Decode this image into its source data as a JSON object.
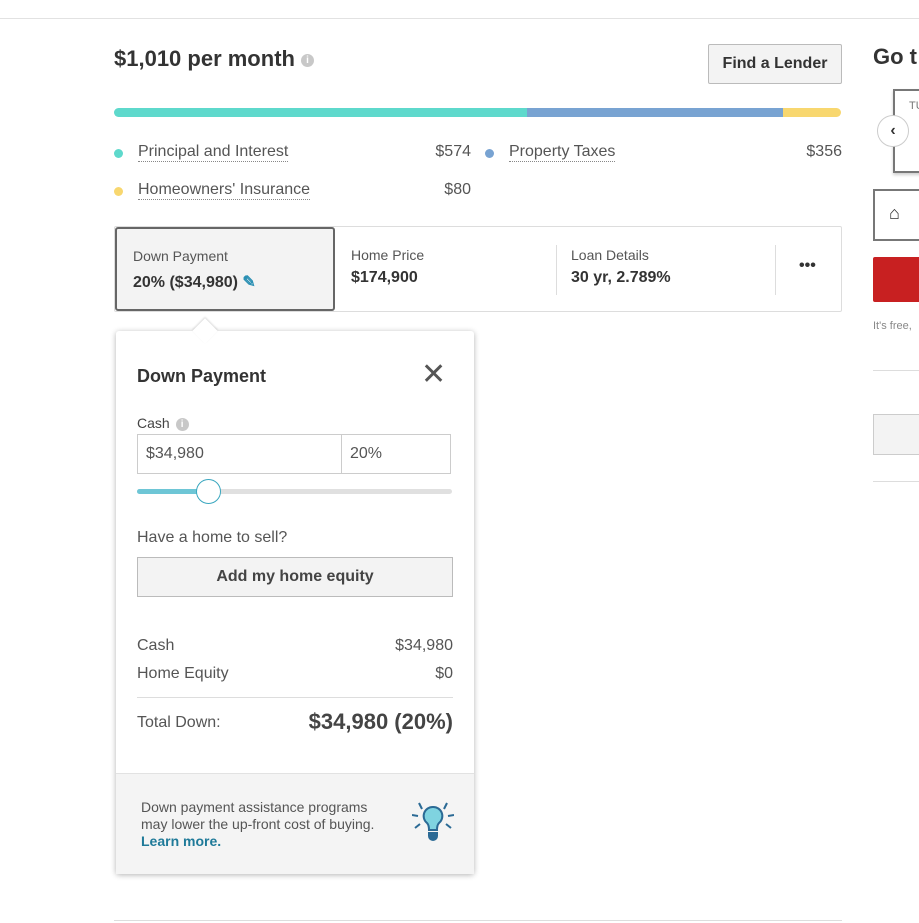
{
  "header": {
    "monthly_payment": "$1,010 per month",
    "find_lender": "Find a Lender"
  },
  "breakdown": {
    "colors": {
      "principal": "#5ed9cc",
      "taxes": "#78a3d2",
      "insurance": "#f8d76f"
    },
    "shares": {
      "principal": 574,
      "taxes": 356,
      "insurance": 80
    },
    "items": [
      {
        "label": "Principal and Interest",
        "value": "$574"
      },
      {
        "label": "Property Taxes",
        "value": "$356"
      },
      {
        "label": "Homeowners' Insurance",
        "value": "$80"
      }
    ]
  },
  "cards": {
    "down_payment": {
      "label": "Down Payment",
      "value": "20% ($34,980)"
    },
    "home_price": {
      "label": "Home Price",
      "value": "$174,900"
    },
    "loan_details": {
      "label": "Loan Details",
      "value": "30 yr, 2.789%"
    },
    "more": "•••"
  },
  "popover": {
    "title": "Down Payment",
    "cash_label": "Cash",
    "cash_value": "$34,980",
    "percent_value": "20%",
    "slider_percent": 20,
    "sell_question": "Have a home to sell?",
    "add_equity": "Add my home equity",
    "summary": [
      {
        "label": "Cash",
        "value": "$34,980"
      },
      {
        "label": "Home Equity",
        "value": "$0"
      }
    ],
    "total_label": "Total Down:",
    "total_value": "$34,980 (20%)",
    "footer_text1": "Down payment assistance programs",
    "footer_text2": "may lower the up-front cost of buying.",
    "learn_more": "Learn more."
  },
  "right": {
    "heading": "Go t",
    "tour_label": "TU",
    "free_text": "It's free,"
  }
}
